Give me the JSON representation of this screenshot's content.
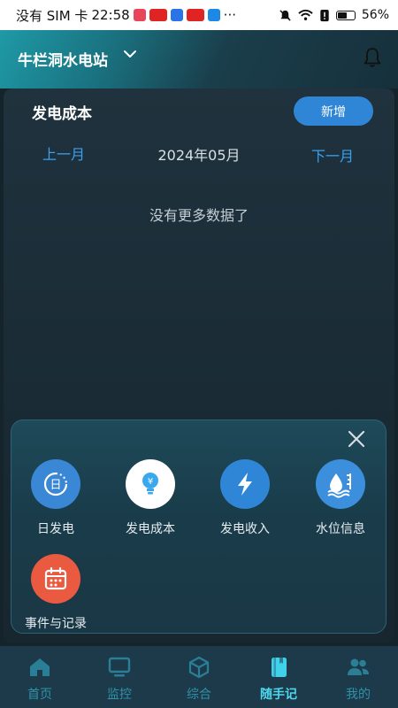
{
  "status_bar": {
    "carrier": "没有 SIM 卡",
    "time": "22:58",
    "battery": "56%",
    "battery_level": 0.56
  },
  "header": {
    "station_name": "牛栏洞水电站"
  },
  "panel": {
    "title": "发电成本",
    "add_label": "新增",
    "prev_month": "上一月",
    "current_month": "2024年05月",
    "next_month": "下一月",
    "empty_message": "没有更多数据了"
  },
  "popup": {
    "items": [
      {
        "label": "日发电",
        "icon": "daily-generation-icon",
        "color": "#3a87d6"
      },
      {
        "label": "发电成本",
        "icon": "lightbulb-yen-icon",
        "color": "#ffffff"
      },
      {
        "label": "发电收入",
        "icon": "lightning-icon",
        "color": "#2f86d6"
      },
      {
        "label": "水位信息",
        "icon": "water-level-icon",
        "color": "#3b8fdc"
      },
      {
        "label": "事件与记录",
        "icon": "calendar-icon",
        "color": "#ea5a40"
      }
    ]
  },
  "bottom_nav": {
    "items": [
      {
        "label": "首页",
        "icon": "home-icon"
      },
      {
        "label": "监控",
        "icon": "monitor-icon"
      },
      {
        "label": "综合",
        "icon": "cube-icon"
      },
      {
        "label": "随手记",
        "icon": "notebook-icon",
        "active": true
      },
      {
        "label": "我的",
        "icon": "user-group-icon"
      }
    ]
  }
}
